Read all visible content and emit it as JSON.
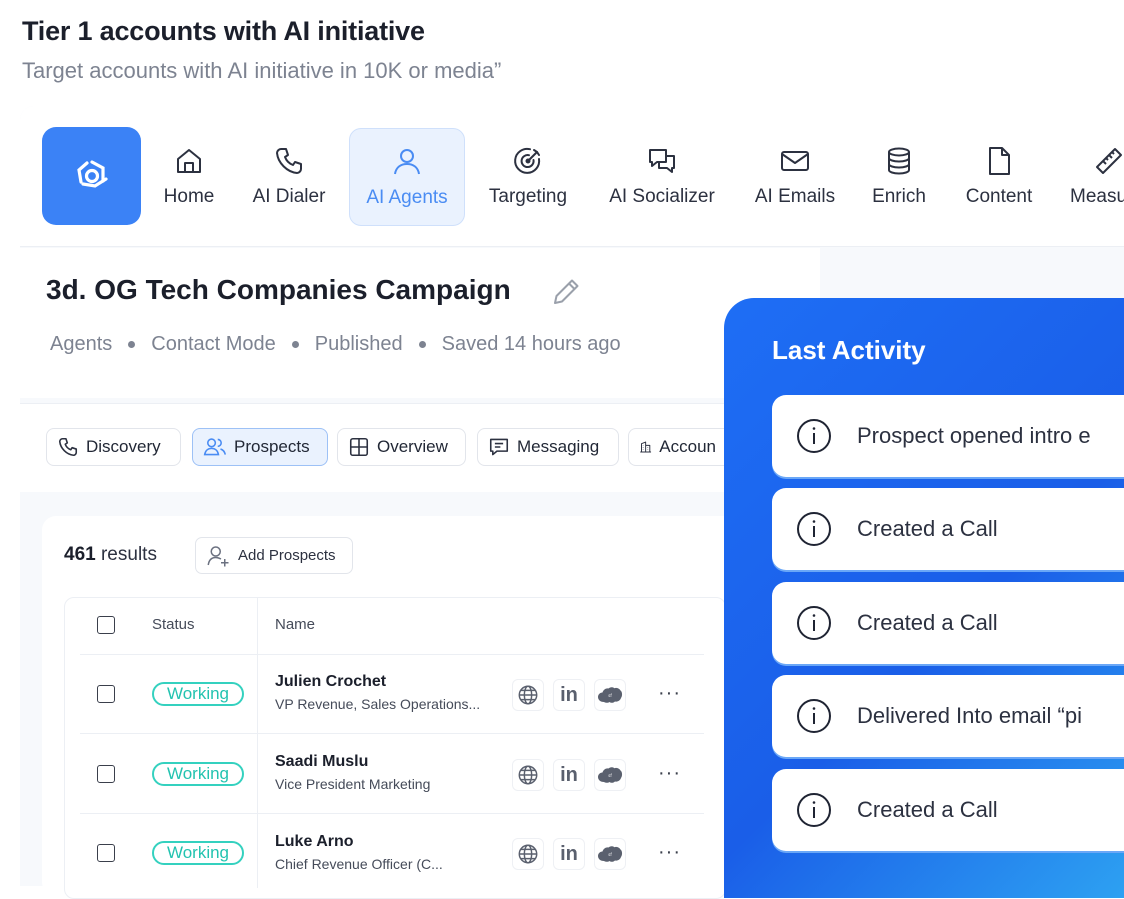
{
  "header": {
    "title": "Tier 1 accounts with AI initiative",
    "subtitle": "Target accounts with AI initiative in 10K or media”"
  },
  "nav": {
    "items": [
      {
        "label": "Home",
        "icon": "home-icon"
      },
      {
        "label": "AI Dialer",
        "icon": "phone-icon"
      },
      {
        "label": "AI Agents",
        "icon": "user-icon",
        "active": true
      },
      {
        "label": "Targeting",
        "icon": "target-icon"
      },
      {
        "label": "AI Socializer",
        "icon": "chat-icon"
      },
      {
        "label": "AI Emails",
        "icon": "mail-icon"
      },
      {
        "label": "Enrich",
        "icon": "database-icon"
      },
      {
        "label": "Content",
        "icon": "file-icon"
      },
      {
        "label": "Measu",
        "icon": "ruler-icon"
      }
    ]
  },
  "campaign": {
    "title": "3d. OG Tech Companies Campaign",
    "crumbs": [
      "Agents",
      "Contact Mode",
      "Published",
      "Saved 14 hours ago"
    ]
  },
  "tabs": [
    {
      "label": "Discovery",
      "icon": "phone-icon"
    },
    {
      "label": "Prospects",
      "icon": "users-icon",
      "active": true
    },
    {
      "label": "Overview",
      "icon": "grid-icon"
    },
    {
      "label": "Messaging",
      "icon": "message-icon"
    },
    {
      "label": "Accoun",
      "icon": "building-icon"
    }
  ],
  "results": {
    "count": "461",
    "count_suffix": " results",
    "add_label": "Add Prospects"
  },
  "table": {
    "headers": {
      "status": "Status",
      "name": "Name"
    },
    "rows": [
      {
        "status": "Working",
        "name": "Julien Crochet",
        "title": "VP Revenue, Sales Operations..."
      },
      {
        "status": "Working",
        "name": "Saadi Muslu",
        "title": "Vice President Marketing"
      },
      {
        "status": "Working",
        "name": "Luke Arno",
        "title": "Chief Revenue Officer (C..."
      }
    ]
  },
  "activity": {
    "title": "Last Activity",
    "items": [
      "Prospect opened intro e",
      "Created a Call",
      "Created a Call",
      "Delivered Into email “pi",
      "Created a Call"
    ]
  },
  "colors": {
    "accent": "#3b82f6",
    "badge": "#34d1bf",
    "panel": "#1e6ef5"
  }
}
